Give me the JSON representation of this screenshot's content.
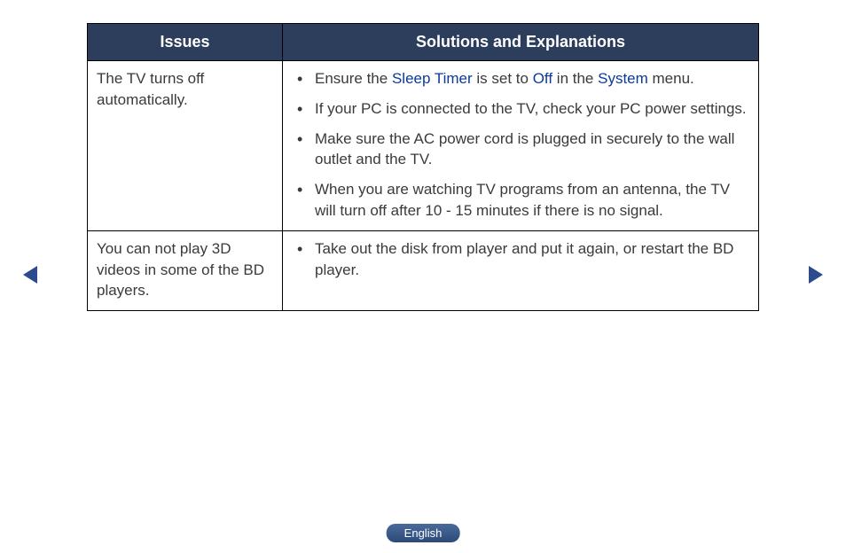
{
  "table": {
    "headers": {
      "issues": "Issues",
      "solutions": "Solutions and Explanations"
    },
    "rows": [
      {
        "issue": "The TV turns off automatically.",
        "solutions": [
          {
            "prefix": "Ensure the ",
            "link1": "Sleep Timer",
            "mid1": " is set to ",
            "link2": "Off",
            "mid2": " in the ",
            "link3": "System",
            "suffix": " menu."
          },
          {
            "text": "If your PC is connected to the TV, check your PC power settings."
          },
          {
            "text": "Make sure the AC power cord is plugged in securely to the wall outlet and the TV."
          },
          {
            "text": "When you are watching TV programs from an antenna, the TV will turn off after 10 - 15 minutes if there is no signal."
          }
        ]
      },
      {
        "issue": "You can not play 3D videos in some of the BD players.",
        "solutions": [
          {
            "text": "Take out the disk from player and put it again, or restart the BD player."
          }
        ]
      }
    ]
  },
  "footer": {
    "language": "English"
  },
  "nav": {
    "prev": "previous-page",
    "next": "next-page"
  }
}
